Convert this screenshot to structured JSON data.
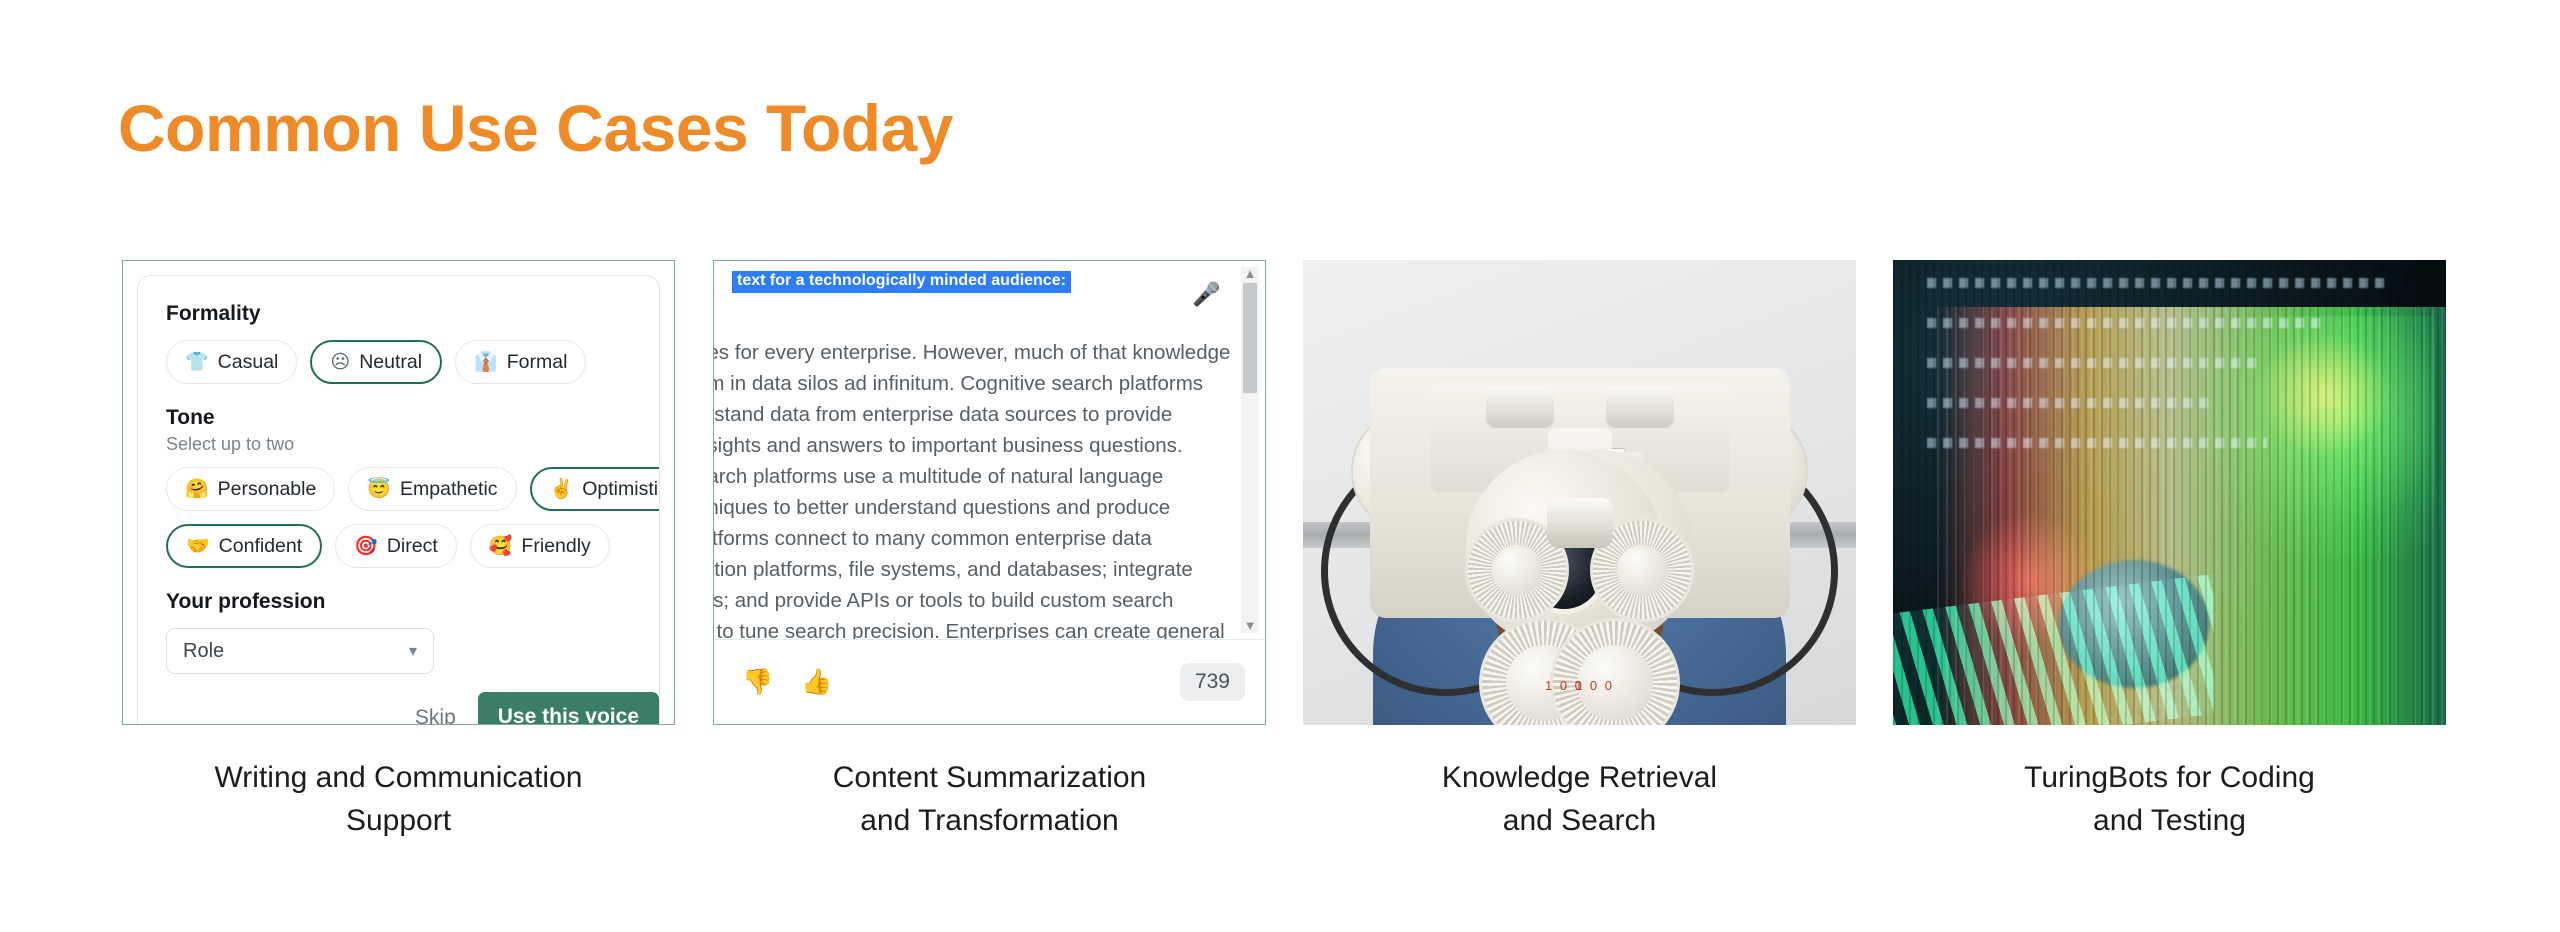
{
  "slide": {
    "title": "Common Use Cases Today",
    "title_color": "#EE8B28",
    "background": "#FFFFFF"
  },
  "cards": [
    {
      "caption_line1": "Writing and Communication",
      "caption_line2": "Support",
      "type": "ui-screenshot",
      "ui": {
        "formality": {
          "label": "Formality",
          "options": [
            {
              "label": "Casual",
              "icon": "tshirt-icon",
              "selected": false
            },
            {
              "label": "Neutral",
              "icon": "neutral-face-icon",
              "selected": true
            },
            {
              "label": "Formal",
              "icon": "dress-shirt-icon",
              "selected": false
            }
          ]
        },
        "tone": {
          "label": "Tone",
          "hint": "Select up to two",
          "options_row1": [
            {
              "label": "Personable",
              "icon": "hugging-face-emoji",
              "glyph": "🤗",
              "selected": false
            },
            {
              "label": "Empathetic",
              "icon": "angel-face-emoji",
              "glyph": "😇",
              "selected": false
            },
            {
              "label": "Optimistic",
              "icon": "victory-hand-emoji",
              "glyph": "✌️",
              "selected": true
            }
          ],
          "options_row2": [
            {
              "label": "Confident",
              "icon": "handshake-emoji",
              "glyph": "🤝",
              "selected": true
            },
            {
              "label": "Direct",
              "icon": "bullseye-emoji",
              "glyph": "🎯",
              "selected": false
            },
            {
              "label": "Friendly",
              "icon": "smiling-face-emoji",
              "glyph": "🥰",
              "selected": false
            }
          ]
        },
        "profession": {
          "label": "Your profession",
          "select_value": "Role"
        },
        "skip_label": "Skip",
        "primary_button_label": "Use this voice",
        "primary_button_color": "#3A7D69",
        "selected_chip_border_color": "#1F6E57"
      }
    },
    {
      "caption_line1": "Content Summarization",
      "caption_line2": "and Transformation",
      "type": "ui-screenshot",
      "doc": {
        "selected_text": "text for a technologically minded audience:",
        "selection_color": "#2F7DF4",
        "body_text": "oes for every enterprise. However, much of that knowledge\num in data silos ad infinitum. Cognitive search platforms\nerstand data from enterprise data sources to provide\nnsights and answers to important business questions.\nearch platforms use a multitude of natural language\nhniques to better understand questions and produce\nlatforms connect to many common enterprise data\nration platforms, file systems, and databases; integrate\nms; and provide APIs or tools to build custom search\nls to tune search precision. Enterprises can create general\nsearch capabilities that give employees, customers, and/or\nrmation that spans multiple data sources and content",
        "mic_icon": "microphone-icon",
        "thumbs_down_icon": "thumbs-down-icon",
        "thumbs_up_icon": "thumbs-up-icon",
        "word_count": "739",
        "scroll_up_arrow": "▲",
        "scroll_down_arrow": "▼"
      }
    },
    {
      "caption_line1": "Knowledge Retrieval",
      "caption_line2": "and Search",
      "type": "photograph",
      "photo": {
        "subject": "phoropter-eye-exam-device",
        "red_reading_left": "1 0 0",
        "red_reading_right": "1 0 0"
      }
    },
    {
      "caption_line1": "TuringBots for Coding",
      "caption_line2": "and Testing",
      "type": "photograph",
      "photo": {
        "subject": "abstract-code-data-visualization"
      }
    }
  ]
}
